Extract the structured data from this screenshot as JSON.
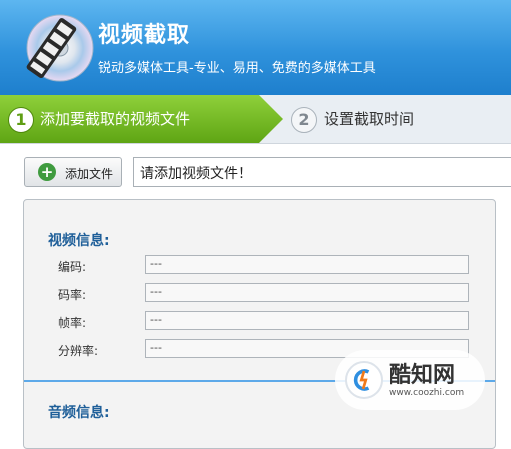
{
  "header": {
    "title": "视频截取",
    "subtitle": "锐动多媒体工具-专业、易用、免费的多媒体工具",
    "logo_icon": "film-reel-cd-icon"
  },
  "steps": [
    {
      "number": "1",
      "label": "添加要截取的视频文件",
      "state": "active"
    },
    {
      "number": "2",
      "label": "设置截取时间",
      "state": "inactive"
    }
  ],
  "file": {
    "add_button_label": "添加文件",
    "add_icon": "plus-icon",
    "path_value": "请添加视频文件！"
  },
  "video_info": {
    "title": "视频信息:",
    "fields": [
      {
        "label": "编码:",
        "value": "---"
      },
      {
        "label": "码率:",
        "value": "---"
      },
      {
        "label": "帧率:",
        "value": "---"
      },
      {
        "label": "分辨率:",
        "value": "---"
      }
    ]
  },
  "audio_info": {
    "title": "音频信息:"
  },
  "watermark": {
    "text": "酷知网",
    "url": "www.coozhi.com"
  },
  "colors": {
    "header_blue": "#2f92dc",
    "step_active_green": "#6fb51c",
    "section_title_blue": "#1f5f99",
    "divider_blue": "#5da9e9"
  }
}
